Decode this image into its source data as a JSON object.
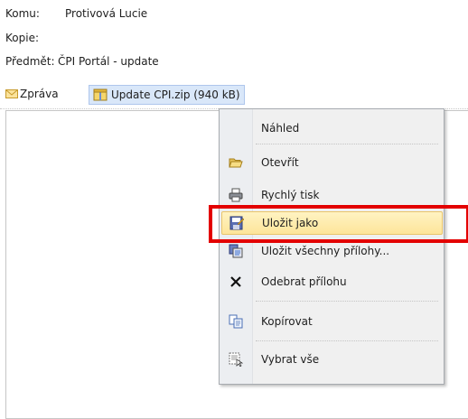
{
  "header": {
    "to_label": "Komu:",
    "to_value": "Protivová Lucie",
    "cc_label": "Kopie:",
    "subject_label": "Předmět:",
    "subject_value": "ČPI Portál - update"
  },
  "tabs": {
    "message": "Zpráva",
    "attachment": "Update CPI.zip (940 kB)"
  },
  "context_menu": {
    "items": [
      {
        "label": "Náhled",
        "icon": "none"
      },
      {
        "label": "Otevřít",
        "icon": "folder-open-icon"
      },
      {
        "label": "Rychlý tisk",
        "icon": "printer-icon"
      },
      {
        "label": "Uložit jako",
        "icon": "save-as-icon",
        "highlighted": true
      },
      {
        "label": "Uložit všechny přílohy...",
        "icon": "save-all-icon"
      },
      {
        "label": "Odebrat přílohu",
        "icon": "remove-x-icon"
      },
      {
        "label": "Kopírovat",
        "icon": "copy-icon"
      },
      {
        "label": "Vybrat vše",
        "icon": "select-all-icon"
      }
    ]
  },
  "colors": {
    "highlight": "#fde59a",
    "callout_border": "#e30000",
    "attachment_tab": "#d9e7f9"
  }
}
